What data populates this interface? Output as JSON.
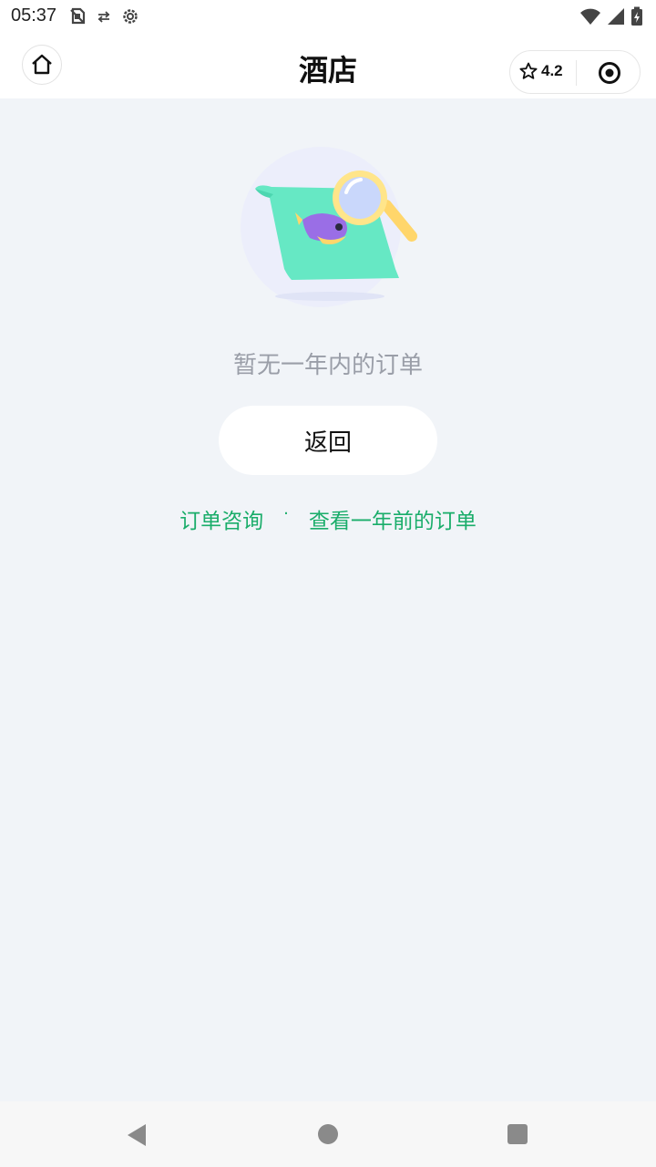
{
  "status_bar": {
    "time": "05:37",
    "left_icons": [
      "no-sim-icon",
      "data-saver-icon",
      "settings-gear-icon"
    ],
    "right_icons": [
      "wifi-icon",
      "cell-signal-icon",
      "battery-charging-icon"
    ]
  },
  "header": {
    "title": "酒店",
    "rating": "4.2",
    "home_icon": "home-icon",
    "star_icon": "star-outline-icon",
    "menu_icon": "target-circle-icon"
  },
  "main": {
    "illustration": "empty-orders-illustration",
    "empty_message": "暂无一年内的订单",
    "back_button_label": "返回",
    "link_consult": "订单咨询",
    "separator": "·",
    "link_older_orders": "查看一年前的订单"
  },
  "colors": {
    "background": "#f1f4f8",
    "accent_green": "#1aad6a",
    "muted_text": "#9a9ea8"
  }
}
